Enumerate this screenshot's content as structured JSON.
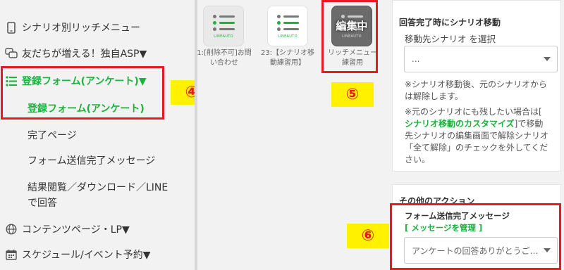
{
  "sidebar": {
    "item_rich_menu": "シナリオ別リッチメニュー",
    "item_friends_asp": "友だちが増える！独自ASP▼",
    "item_form_group": "登録フォーム(アンケート)▼",
    "item_form_active": "登録フォーム(アンケート)",
    "item_complete_page": "完了ページ",
    "item_form_message": "フォーム送信完了メッセージ",
    "item_results_line1": "結果閲覧／ダウンロード／LINE",
    "item_results_line2": "で回答",
    "item_content_page": "コンテンツページ・LP▼",
    "item_schedule": "スケジュール/イベント予約▼"
  },
  "badges": {
    "four": "④",
    "five": "⑤",
    "six": "⑥"
  },
  "scenarios": {
    "items": [
      {
        "caption_line1": "1:[削除不可]お問",
        "caption_line2": "い合わせ"
      },
      {
        "caption_line1": "23:【シナリオ移",
        "caption_line2": "動練習用】"
      },
      {
        "caption_line1": "リッチメニュー",
        "caption_line2": "練習用"
      }
    ],
    "editing_label": "編集中",
    "thumb_tag": "LINEAUTO"
  },
  "scenario_move": {
    "title": "回答完了時にシナリオ移動",
    "label": "移動先シナリオ を選択",
    "select_value": "...",
    "note1_line1": "※シナリオ移動後、元のシナリオから",
    "note1_line2": "は解除します。",
    "note2_line1": "※元のシナリオにも残したい場合は[",
    "note2_link": "シナリオ移動のカスタマイズ",
    "note2_line2_rest": "]で移動",
    "note2_line3": "先シナリオの編集画面で解除シナリオ",
    "note2_line4": "「全て解除」のチェックを外してくだ",
    "note2_line5": "さい。"
  },
  "other_actions": {
    "title": "その他のアクション",
    "message_label": "フォーム送信完了メッセージ",
    "manage_link_open": "[ ",
    "manage_link": "メッセージを管理",
    "manage_link_close": " ]",
    "message_select_value": "アンケートの回答ありがとうご…"
  },
  "colors": {
    "accent_green": "#19b23b",
    "highlight_red": "#e41b23",
    "badge_yellow": "#fff100"
  },
  "icons": {
    "rich_menu": "smartphone-icon",
    "friends_asp": "chat-bubbles-icon",
    "form": "list-icon",
    "content_page": "globe-icon",
    "schedule": "calendar-icon"
  }
}
